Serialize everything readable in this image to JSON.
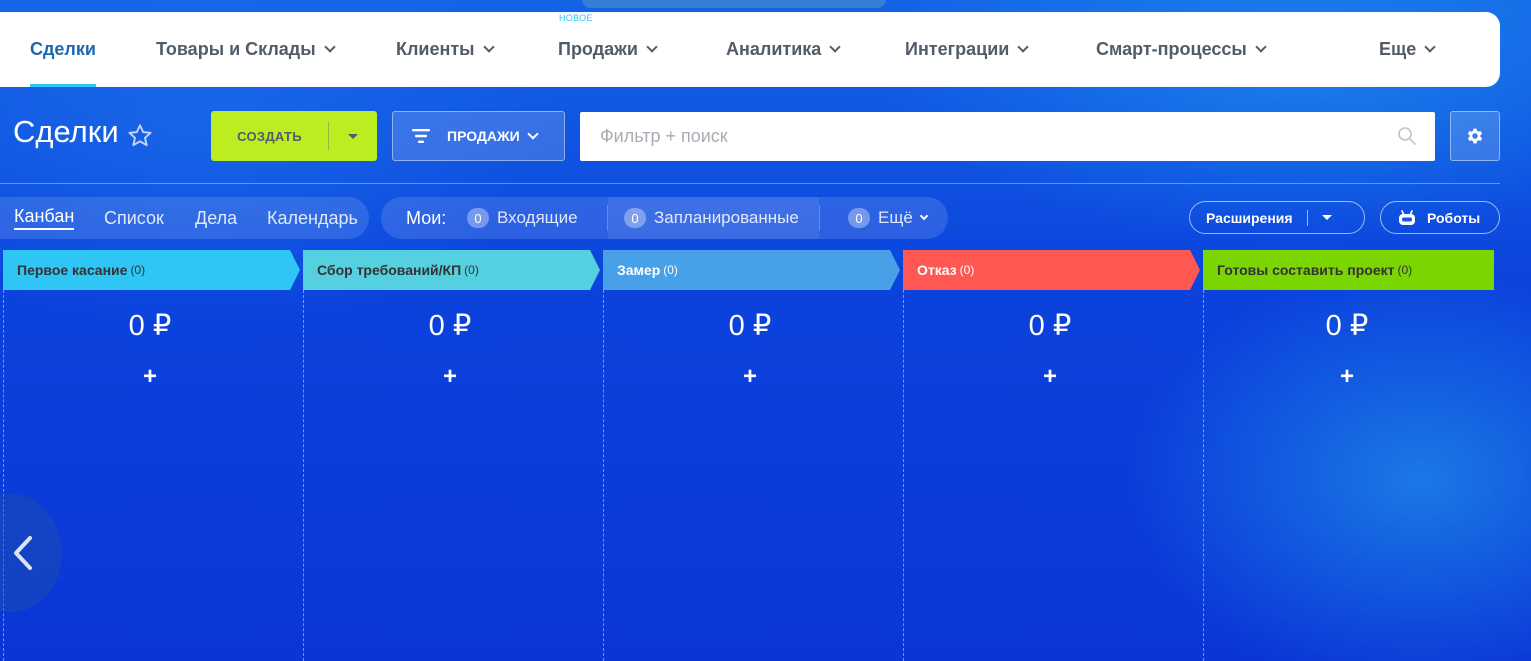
{
  "nav": {
    "items": [
      {
        "label": "Сделки",
        "active": true,
        "dropdown": false
      },
      {
        "label": "Товары и Склады",
        "dropdown": true
      },
      {
        "label": "Клиенты",
        "dropdown": true
      },
      {
        "label": "Продажи",
        "dropdown": true,
        "badge": "НОВОЕ"
      },
      {
        "label": "Аналитика",
        "dropdown": true
      },
      {
        "label": "Интеграции",
        "dropdown": true
      },
      {
        "label": "Смарт-процессы",
        "dropdown": true
      },
      {
        "label": "Еще",
        "dropdown": true
      }
    ]
  },
  "toolbar": {
    "title": "Сделки",
    "create_label": "СОЗДАТЬ",
    "sales_label": "ПРОДАЖИ",
    "search_placeholder": "Фильтр + поиск"
  },
  "views": {
    "items": [
      {
        "label": "Канбан",
        "active": true
      },
      {
        "label": "Список"
      },
      {
        "label": "Дела"
      },
      {
        "label": "Календарь"
      }
    ]
  },
  "counters": {
    "mine_label": "Мои:",
    "items": [
      {
        "count": "0",
        "label": "Входящие"
      },
      {
        "count": "0",
        "label": "Запланированные"
      },
      {
        "count": "0",
        "label": "Ещё"
      }
    ]
  },
  "buttons": {
    "extensions": "Расширения",
    "robots": "Роботы"
  },
  "stages": [
    {
      "name": "Первое касание",
      "count": "(0)",
      "sum": "0 ₽",
      "color": "#2fc6f6"
    },
    {
      "name": "Сбор требований/КП",
      "count": "(0)",
      "sum": "0 ₽",
      "color": "#55d0e0"
    },
    {
      "name": "Замер",
      "count": "(0)",
      "sum": "0 ₽",
      "color": "#47a0e8"
    },
    {
      "name": "Отказ",
      "count": "(0)",
      "sum": "0 ₽",
      "color": "#ff5752"
    },
    {
      "name": "Готовы составить проект",
      "count": "(0)",
      "sum": "0 ₽",
      "color": "#7bd500"
    }
  ],
  "icons": {
    "star": "star-icon",
    "search": "search-icon",
    "gear": "gear-icon",
    "robot": "robot-icon",
    "back": "chevron-left-icon"
  }
}
